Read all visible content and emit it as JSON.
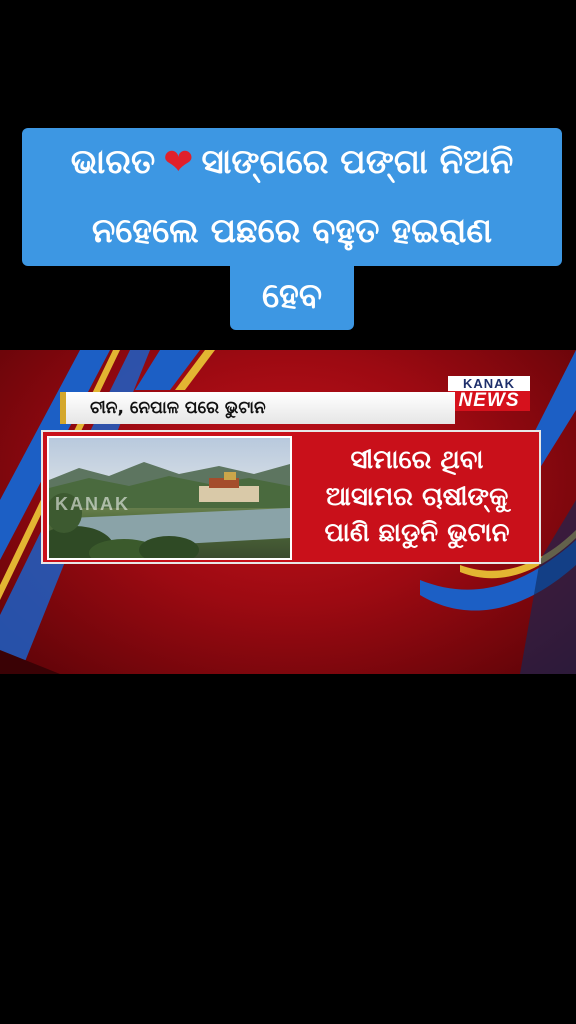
{
  "caption": {
    "line1_part1": "ଭାରତ",
    "heart_glyph": "❤",
    "line1_part2": "ସାଙ୍ଗରେ ପଙ୍ଗା ନିଅନି",
    "line2": "ନହେଲେ ପଛରେ ବହୁତ ହଇରାଣ",
    "line3": "ହେବ"
  },
  "news": {
    "logo_top": "KANAK",
    "logo_bottom": "NEWS",
    "ticker_text": "ଚୀନ, ନେପାଳ ପରେ ଭୁଟାନ",
    "watermark": "KANAK",
    "headline_lines": [
      "ସୀମାରେ ଥିବା",
      "ଆସାମର ଚାଷୀଙ୍କୁ",
      "ପାଣି ଛାଡୁନି ଭୁଟାନ"
    ]
  },
  "colors": {
    "caption_bg": "#3d97e3",
    "news_red": "#c9101a",
    "accent_blue": "#1c5fc5",
    "accent_yellow": "#e3b532",
    "heart": "#e0202b"
  }
}
